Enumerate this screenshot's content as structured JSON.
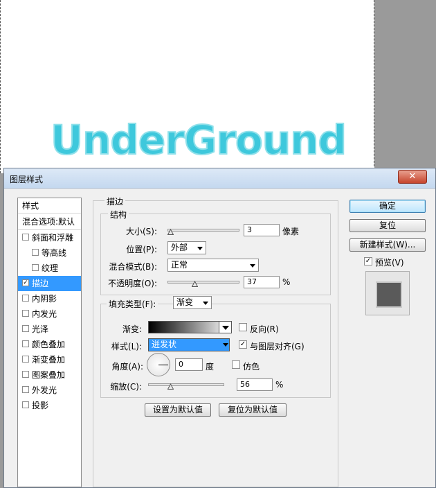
{
  "canvas": {
    "art_text": "UnderGround"
  },
  "dialog": {
    "title": "图层样式",
    "close_icon": "close-x-icon"
  },
  "styles_list": {
    "header": "样式",
    "blend_options": "混合选项:默认",
    "items": [
      {
        "label": "斜面和浮雕",
        "checked": false,
        "indent": false
      },
      {
        "label": "等高线",
        "checked": false,
        "indent": true
      },
      {
        "label": "纹理",
        "checked": false,
        "indent": true
      },
      {
        "label": "描边",
        "checked": true,
        "indent": false,
        "selected": true
      },
      {
        "label": "内阴影",
        "checked": false,
        "indent": false
      },
      {
        "label": "内发光",
        "checked": false,
        "indent": false
      },
      {
        "label": "光泽",
        "checked": false,
        "indent": false
      },
      {
        "label": "颜色叠加",
        "checked": false,
        "indent": false
      },
      {
        "label": "渐变叠加",
        "checked": false,
        "indent": false
      },
      {
        "label": "图案叠加",
        "checked": false,
        "indent": false
      },
      {
        "label": "外发光",
        "checked": false,
        "indent": false
      },
      {
        "label": "投影",
        "checked": false,
        "indent": false
      }
    ]
  },
  "stroke": {
    "group_title": "描边",
    "structure_title": "结构",
    "size_label": "大小(S):",
    "size_value": "3",
    "size_unit": "像素",
    "size_fraction": 0.0,
    "position_label": "位置(P):",
    "position_value": "外部",
    "blend_mode_label": "混合模式(B):",
    "blend_mode_value": "正常",
    "opacity_label": "不透明度(O):",
    "opacity_value": "37",
    "opacity_unit": "%",
    "opacity_fraction": 0.37,
    "fill_type_label": "填充类型(F):",
    "fill_type_value": "渐变",
    "gradient_label": "渐变:",
    "reverse_label": "反向(R)",
    "reverse_checked": false,
    "style_label": "样式(L):",
    "style_value": "迸发状",
    "align_label": "与图层对齐(G)",
    "align_checked": true,
    "angle_label": "角度(A):",
    "angle_value": "0",
    "angle_unit": "度",
    "dither_label": "仿色",
    "dither_checked": false,
    "scale_label": "缩放(C):",
    "scale_value": "56",
    "scale_unit": "%",
    "scale_fraction": 0.28,
    "set_default_button": "设置为默认值",
    "reset_default_button": "复位为默认值"
  },
  "buttons": {
    "ok": "确定",
    "reset": "复位",
    "new_style": "新建样式(W)...",
    "preview_label": "预览(V)",
    "preview_checked": true
  }
}
